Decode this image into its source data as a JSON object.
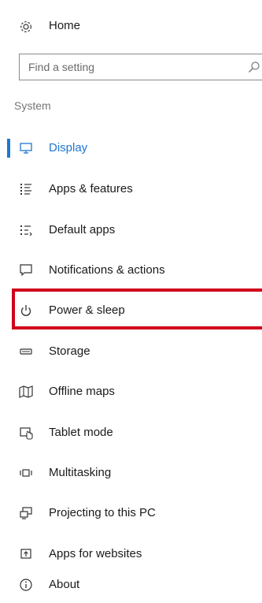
{
  "home": {
    "label": "Home",
    "icon": "gear-icon"
  },
  "search": {
    "placeholder": "Find a setting",
    "icon": "search-icon"
  },
  "section": {
    "title": "System"
  },
  "accent_color": "#1f77d0",
  "highlight_color": "#d0021b",
  "nav": {
    "items": [
      {
        "label": "Display",
        "icon": "monitor-icon",
        "active": true
      },
      {
        "label": "Apps & features",
        "icon": "list-icon"
      },
      {
        "label": "Default apps",
        "icon": "default-apps-icon"
      },
      {
        "label": "Notifications & actions",
        "icon": "message-icon"
      },
      {
        "label": "Power & sleep",
        "icon": "power-icon",
        "highlighted": true
      },
      {
        "label": "Storage",
        "icon": "drive-icon"
      },
      {
        "label": "Offline maps",
        "icon": "map-icon"
      },
      {
        "label": "Tablet mode",
        "icon": "tablet-icon"
      },
      {
        "label": "Multitasking",
        "icon": "multitask-icon"
      },
      {
        "label": "Projecting to this PC",
        "icon": "project-icon"
      },
      {
        "label": "Apps for websites",
        "icon": "web-app-icon"
      },
      {
        "label": "About",
        "icon": "info-icon"
      }
    ]
  }
}
